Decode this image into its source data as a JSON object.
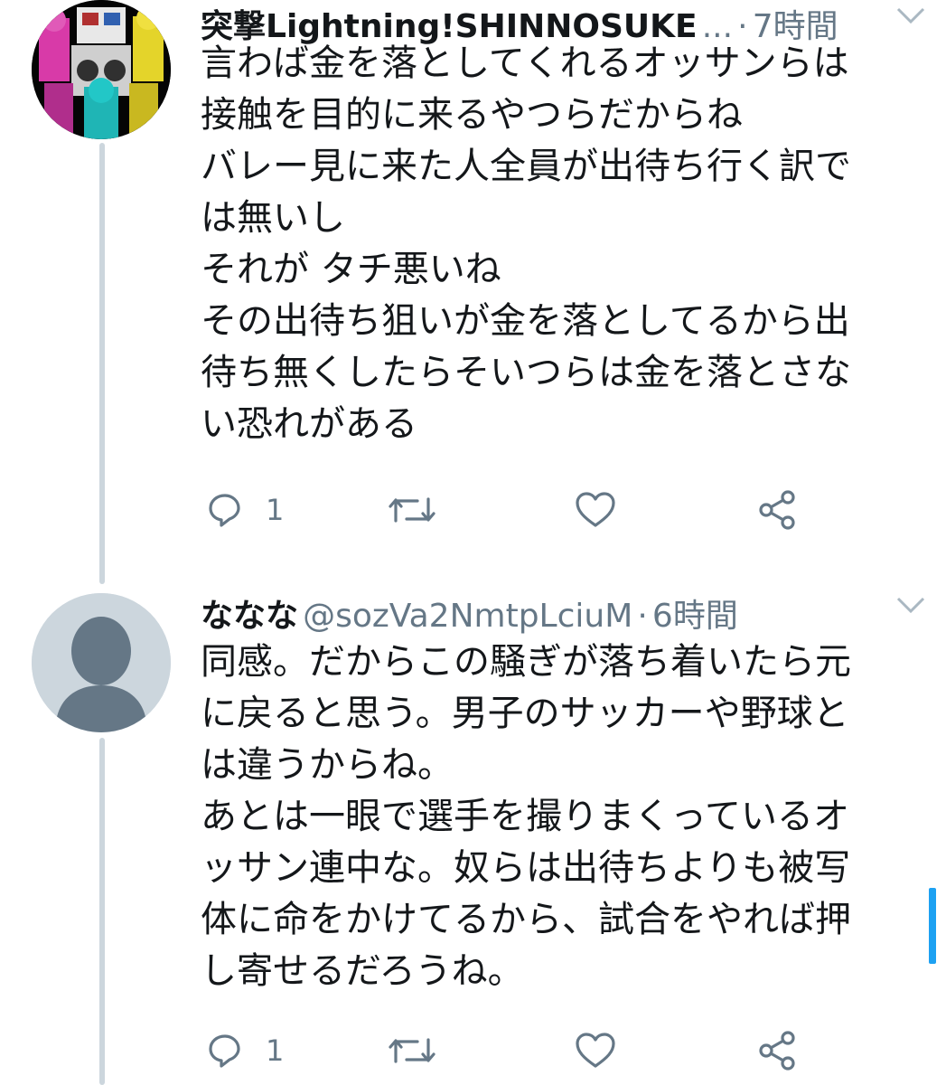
{
  "tweets": [
    {
      "name": "突撃Lightning!SHINNOSUKE",
      "handle_truncated": "...",
      "dot": "·",
      "time": "7時間",
      "text": "言わば金を落としてくれるオッサンらは\n接触を目的に来るやつらだからね\nバレー見に来た人全員が出待ち行く訳で\nは無いし\nそれが タチ悪いね\nその出待ち狙いが金を落としてるから出\n待ち無くしたらそいつらは金を落とさな\nい恐れがある",
      "reply_count": "1",
      "retweet_count": "",
      "like_count": "",
      "avatar": "sentai-hero-group"
    },
    {
      "name": "ななな",
      "handle": "@sozVa2NmtpLciuM",
      "dot": "·",
      "time": "6時間",
      "text": "同感。だからこの騒ぎが落ち着いたら元\nに戻ると思う。男子のサッカーや野球と\nは違うからね。\nあとは一眼で選手を撮りまくっているオ\nッサン連中な。奴らは出待ちよりも被写\n体に命をかけてるから、試合をやれば押\nし寄せるだろうね。",
      "reply_count": "1",
      "retweet_count": "",
      "like_count": "",
      "avatar": "default-user"
    }
  ],
  "icons": {
    "reply": "reply-icon",
    "retweet": "retweet-icon",
    "like": "heart-icon",
    "share": "share-icon",
    "menu": "chevron-down-icon"
  },
  "colors": {
    "text": "#14171a",
    "secondary": "#657786",
    "thread_line": "#ccd6dd",
    "scroll_indicator": "#1da1f2"
  }
}
